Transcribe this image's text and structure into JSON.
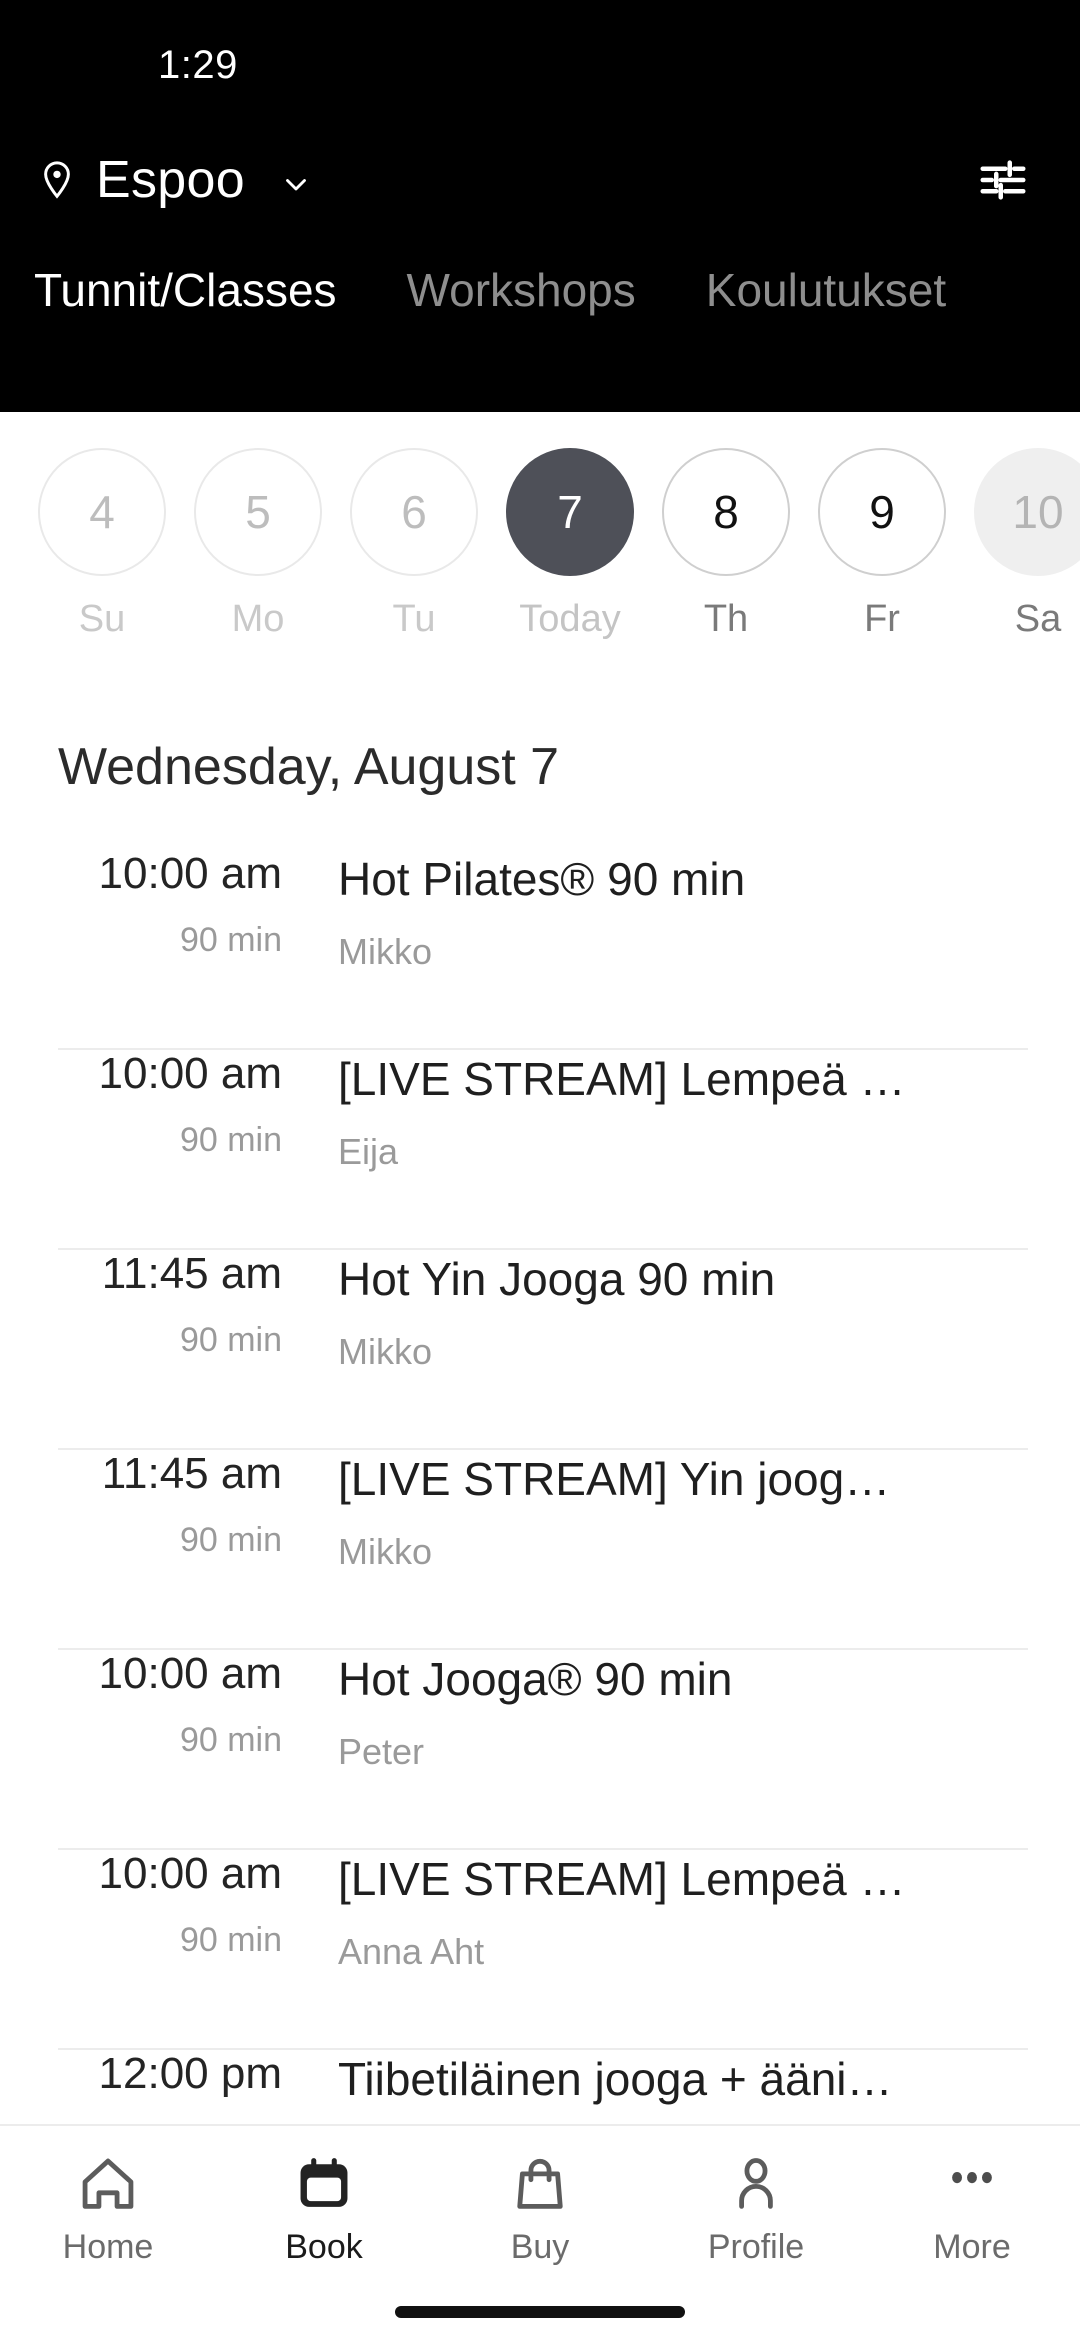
{
  "status_bar": {
    "time": "1:29"
  },
  "header": {
    "location": "Espoo",
    "pin_icon": "location-pin-icon",
    "chevron_icon": "chevron-down-icon",
    "filter_icon": "tune-sliders-icon",
    "tabs": [
      {
        "label": "Tunnit/Classes",
        "active": true
      },
      {
        "label": "Workshops",
        "active": false
      },
      {
        "label": "Koulutukset",
        "active": false
      }
    ]
  },
  "date_strip": [
    {
      "day": "4",
      "dow": "Su",
      "state": "disabled"
    },
    {
      "day": "5",
      "dow": "Mo",
      "state": "disabled"
    },
    {
      "day": "6",
      "dow": "Tu",
      "state": "disabled"
    },
    {
      "day": "7",
      "dow": "Today",
      "state": "selected"
    },
    {
      "day": "8",
      "dow": "Th",
      "state": "enabled"
    },
    {
      "day": "9",
      "dow": "Fr",
      "state": "enabled"
    },
    {
      "day": "10",
      "dow": "Sa",
      "state": "muted"
    }
  ],
  "day_heading": "Wednesday, August 7",
  "classes": [
    {
      "start": "10:00 am",
      "duration": "90 min",
      "title": "Hot Pilates® 90 min",
      "staff": "Mikko"
    },
    {
      "start": "10:00 am",
      "duration": "90 min",
      "title": "[LIVE STREAM] Lempeä …",
      "staff": "Eija"
    },
    {
      "start": "11:45 am",
      "duration": "90 min",
      "title": "Hot Yin Jooga 90 min",
      "staff": "Mikko"
    },
    {
      "start": "11:45 am",
      "duration": "90 min",
      "title": "[LIVE STREAM] Yin joog…",
      "staff": "Mikko"
    },
    {
      "start": "10:00 am",
      "duration": "90 min",
      "title": "Hot Jooga® 90 min",
      "staff": "Peter"
    },
    {
      "start": "10:00 am",
      "duration": "90 min",
      "title": "[LIVE STREAM] Lempeä …",
      "staff": "Anna Aht"
    },
    {
      "start": "12:00 pm",
      "duration": "",
      "title": "Tiibetiläinen jooga + ääni…",
      "staff": ""
    }
  ],
  "bottom_nav": [
    {
      "label": "Home",
      "icon": "home-icon",
      "active": false
    },
    {
      "label": "Book",
      "icon": "calendar-icon",
      "active": true
    },
    {
      "label": "Buy",
      "icon": "shopping-bag-icon",
      "active": false
    },
    {
      "label": "Profile",
      "icon": "person-icon",
      "active": false
    },
    {
      "label": "More",
      "icon": "ellipsis-icon",
      "active": false
    }
  ],
  "colors": {
    "header_bg": "#000000",
    "selected_date": "#4e5058",
    "page_bg": "#ffffff",
    "muted_text": "#9a9a9a",
    "divider": "#ececec"
  }
}
